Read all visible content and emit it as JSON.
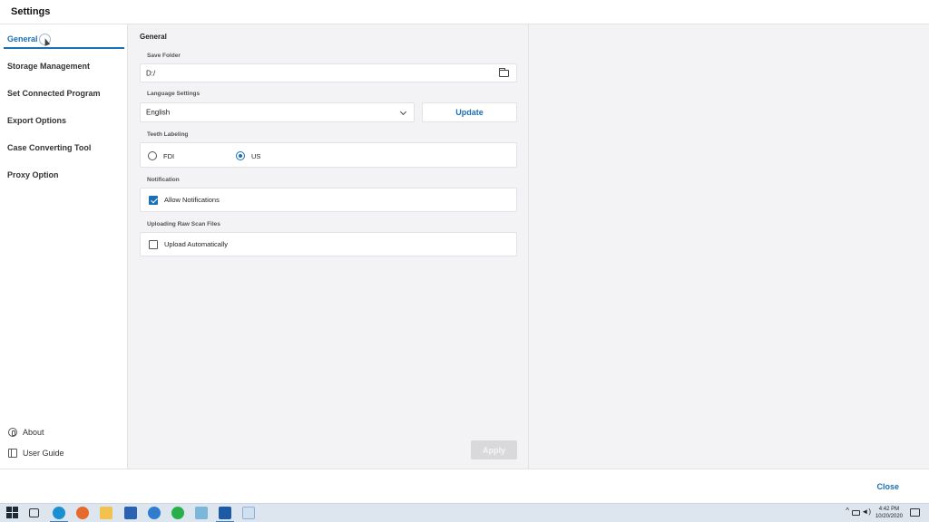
{
  "window": {
    "title": "Settings"
  },
  "sidebar": {
    "items": [
      {
        "label": "General"
      },
      {
        "label": "Storage Management"
      },
      {
        "label": "Set Connected Program"
      },
      {
        "label": "Export Options"
      },
      {
        "label": "Case Converting Tool"
      },
      {
        "label": "Proxy Option"
      }
    ],
    "about_label": "About",
    "user_guide_label": "User Guide"
  },
  "general": {
    "section_title": "General",
    "save_folder": {
      "label": "Save Folder",
      "value": "D:/"
    },
    "language": {
      "label": "Language Settings",
      "selected": "English",
      "update_label": "Update"
    },
    "teeth_labeling": {
      "label": "Teeth Labeling",
      "options": [
        "FDI",
        "US"
      ],
      "selected": "US"
    },
    "notification": {
      "label": "Notification",
      "checkbox_label": "Allow Notifications",
      "checked": true
    },
    "uploading": {
      "label": "Uploading Raw Scan Files",
      "checkbox_label": "Upload Automatically",
      "checked": false
    },
    "apply_label": "Apply"
  },
  "footer": {
    "close_label": "Close"
  },
  "taskbar": {
    "time": "4:42 PM",
    "date": "10/20/2020"
  },
  "colors": {
    "accent": "#1a6fb5",
    "panel": "#f3f3f5"
  }
}
